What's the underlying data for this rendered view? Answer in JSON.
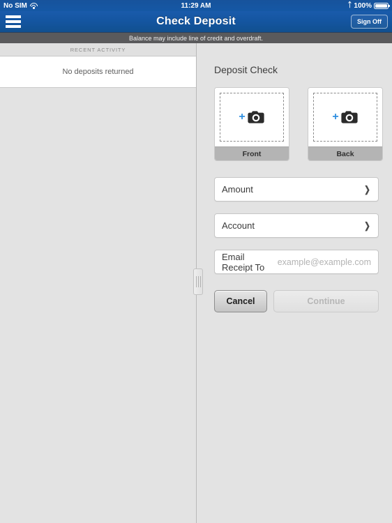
{
  "status_bar": {
    "carrier": "No SIM",
    "wifi_icon": "wifi-icon",
    "time": "11:29 AM",
    "bluetooth_icon": "bluetooth-icon",
    "battery_percent": "100%",
    "battery_icon": "battery-icon"
  },
  "nav": {
    "menu_icon": "hamburger-menu-icon",
    "title": "Check Deposit",
    "sign_off_label": "Sign Off"
  },
  "banner": {
    "text": "Balance may include line of credit and overdraft."
  },
  "sidebar": {
    "section_header": "RECENT ACTIVITY",
    "empty_message": "No deposits returned"
  },
  "main": {
    "section_title": "Deposit Check",
    "capture_cards": [
      {
        "label": "Front",
        "plus_icon": "plus-icon",
        "camera_icon": "camera-icon"
      },
      {
        "label": "Back",
        "plus_icon": "plus-icon",
        "camera_icon": "camera-icon"
      }
    ],
    "fields": [
      {
        "label": "Amount",
        "value": "",
        "chevron_icon": "chevron-right-icon"
      },
      {
        "label": "Account",
        "value": "",
        "chevron_icon": "chevron-right-icon"
      }
    ],
    "email_field": {
      "label": "Email Receipt To",
      "value": "",
      "placeholder": "example@example.com"
    },
    "buttons": {
      "cancel_label": "Cancel",
      "continue_label": "Continue"
    }
  },
  "colors": {
    "nav_blue": "#1455a0",
    "banner_gray": "#5a5a5c",
    "panel_bg": "#e3e3e3",
    "accent_blue": "#2f8fe0",
    "label_bar": "#b4b4b4"
  }
}
